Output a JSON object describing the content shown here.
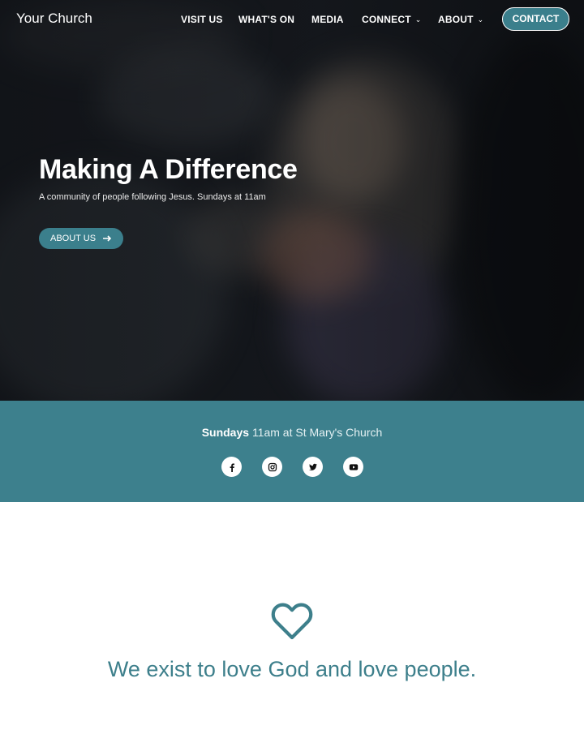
{
  "brand": {
    "name": "Your Church"
  },
  "nav": {
    "items": [
      {
        "label": "VISIT US",
        "has_dropdown": false
      },
      {
        "label": "WHAT'S ON",
        "has_dropdown": false
      },
      {
        "label": "MEDIA",
        "has_dropdown": false
      },
      {
        "label": "CONNECT",
        "has_dropdown": true
      },
      {
        "label": "ABOUT",
        "has_dropdown": true
      }
    ],
    "contact_label": "CONTACT"
  },
  "hero": {
    "title": "Making A Difference",
    "subtitle": "A community of people following Jesus. Sundays at 11am",
    "button_label": "ABOUT US",
    "button_icon": "arrow-right-icon"
  },
  "band": {
    "day": "Sundays",
    "details": "11am at St Mary's Church",
    "socials": [
      {
        "icon": "facebook-icon"
      },
      {
        "icon": "instagram-icon"
      },
      {
        "icon": "twitter-icon"
      },
      {
        "icon": "youtube-icon"
      }
    ]
  },
  "mission": {
    "icon": "heart-icon",
    "text": "We exist to love God and love people."
  },
  "colors": {
    "accent": "#3d808d",
    "accent_dark": "#3b7f8c",
    "text_white": "#ffffff"
  }
}
